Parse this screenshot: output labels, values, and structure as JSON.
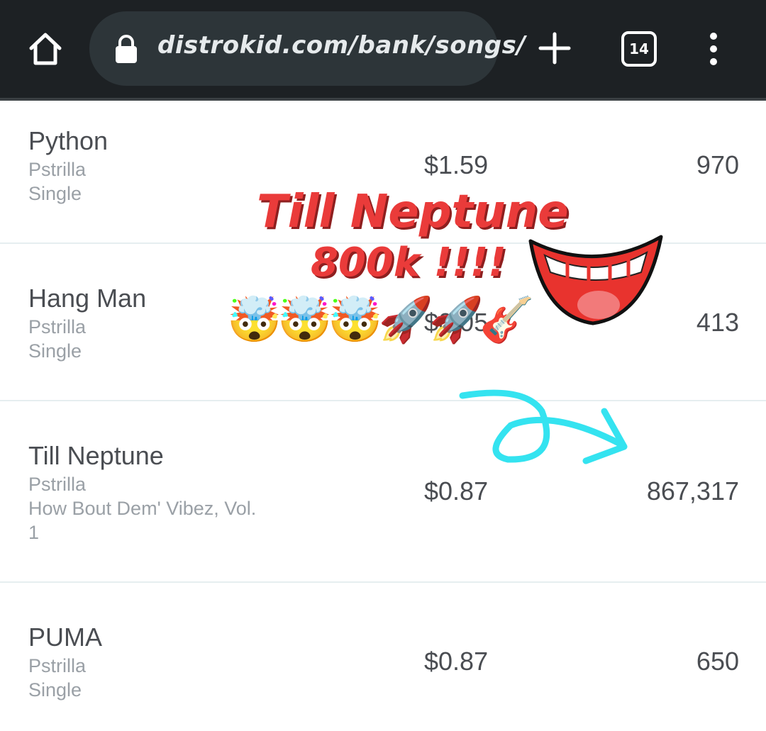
{
  "browser": {
    "url": "distrokid.com/bank/songs/",
    "tab_count": "14",
    "icons": [
      "home-icon",
      "lock-icon",
      "plus-icon",
      "tabs-icon",
      "more-vert-icon"
    ]
  },
  "songs": [
    {
      "title": "Python",
      "artist": "Pstrilla",
      "release": "Single",
      "amount": "$1.59",
      "count": "970"
    },
    {
      "title": "Hang Man",
      "artist": "Pstrilla",
      "release": "Single",
      "amount": "$0.05",
      "count": "413"
    },
    {
      "title": "Till Neptune",
      "artist": "Pstrilla",
      "release": "How Bout Dem' Vibez, Vol. 1",
      "amount": "$0.87",
      "count": "867,317"
    },
    {
      "title": "PUMA",
      "artist": "Pstrilla",
      "release": "Single",
      "amount": "$0.87",
      "count": "650"
    }
  ],
  "overlay": {
    "headline": "Till Neptune",
    "subline": "800k !!!!",
    "emojis": "🤯🤯🤯🚀🚀🎸",
    "colors": {
      "headline": "#ea3b3a",
      "arrow": "#34e3f0",
      "mouth": "#e8332e"
    }
  }
}
